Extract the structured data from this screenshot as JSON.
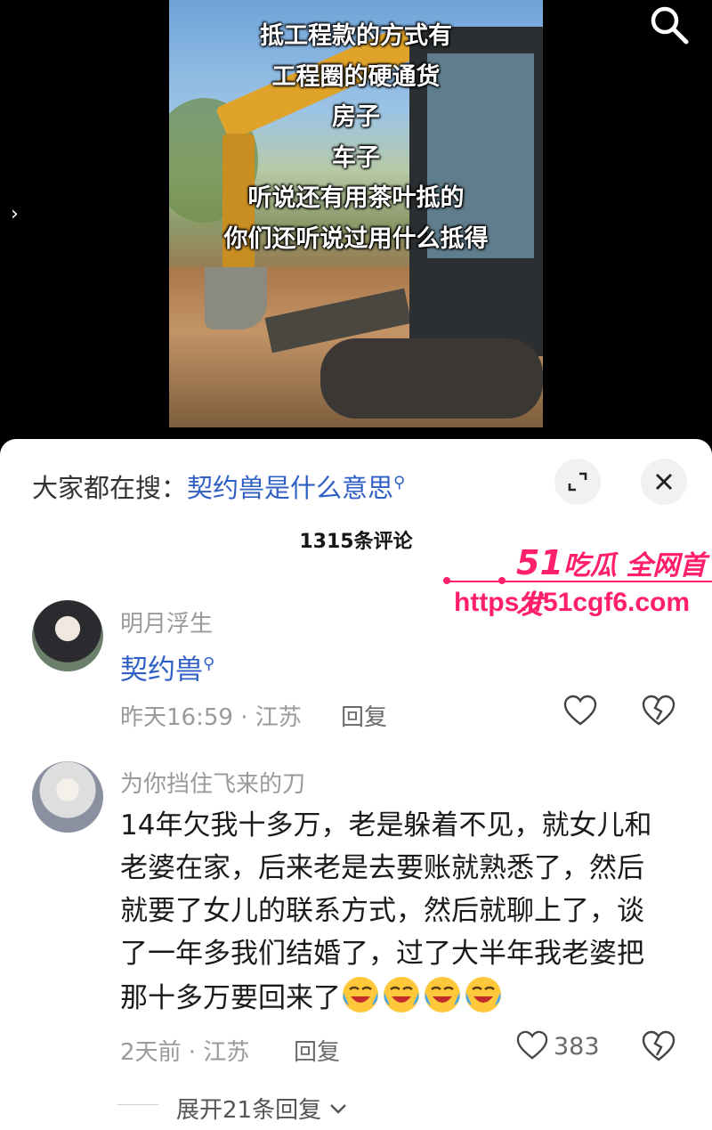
{
  "video": {
    "caption_lines": [
      "抵工程款的方式有",
      "工程圈的硬通货",
      "房子",
      "车子",
      "听说还有用茶叶抵的",
      "你们还听说过用什么抵得"
    ],
    "side_arrow": "›"
  },
  "panel": {
    "hot_prefix": "大家都在搜：",
    "hot_keyword": "契约兽是什么意思",
    "comment_count": "1315条评论"
  },
  "watermark": {
    "brand_num": "51",
    "brand_text": "吃瓜 全网首发",
    "url": "https://51cgf6.com"
  },
  "comments": [
    {
      "user": "明月浮生",
      "text": "契约兽",
      "time": "昨天16:59 · 江苏",
      "reply": "回复"
    },
    {
      "user": "为你挡住飞来的刀",
      "text": "14年欠我十多万，老是躲着不见，就女儿和老婆在家，后来老是去要账就熟悉了，然后就要了女儿的联系方式，然后就聊上了，谈了一年多我们结婚了，过了大半年我老婆把那十多万要回来了",
      "time": "2天前 · 江苏",
      "reply": "回复",
      "likes": "383",
      "expand": "展开21条回复"
    }
  ],
  "colors": {
    "link": "#2f5fc4",
    "watermark": "#ff1f6a"
  }
}
